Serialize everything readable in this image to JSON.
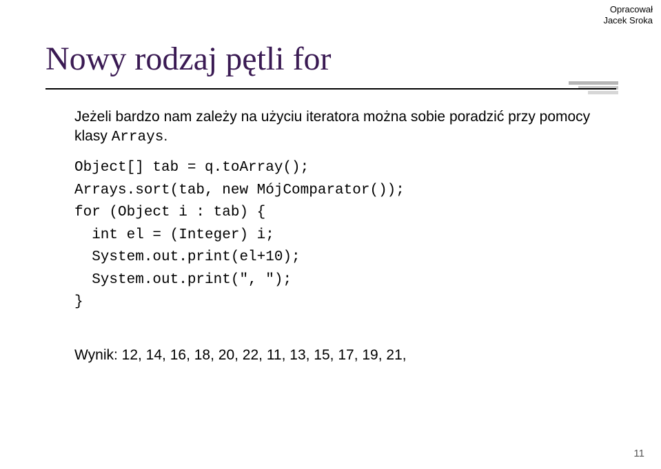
{
  "attribution": {
    "line1": "Opracował",
    "line2": "Jacek Sroka"
  },
  "title": "Nowy rodzaj pętli for",
  "intro": {
    "part1": "Jeżeli bardzo nam zależy na użyciu iteratora można sobie poradzić przy pomocy klasy ",
    "inline_code": "Arrays",
    "part2": "."
  },
  "code": {
    "l1": "Object[] tab = q.toArray();",
    "l2": "Arrays.sort(tab, new MójComparator());",
    "l3": "for (Object i : tab) {",
    "l4": "  int el = (Integer) i;",
    "l5": "  System.out.print(el+10);",
    "l6": "  System.out.print(\", \");",
    "l7": "}"
  },
  "result": "Wynik: 12, 14, 16, 18, 20, 22, 11, 13, 15, 17, 19, 21,",
  "page_number": "11"
}
